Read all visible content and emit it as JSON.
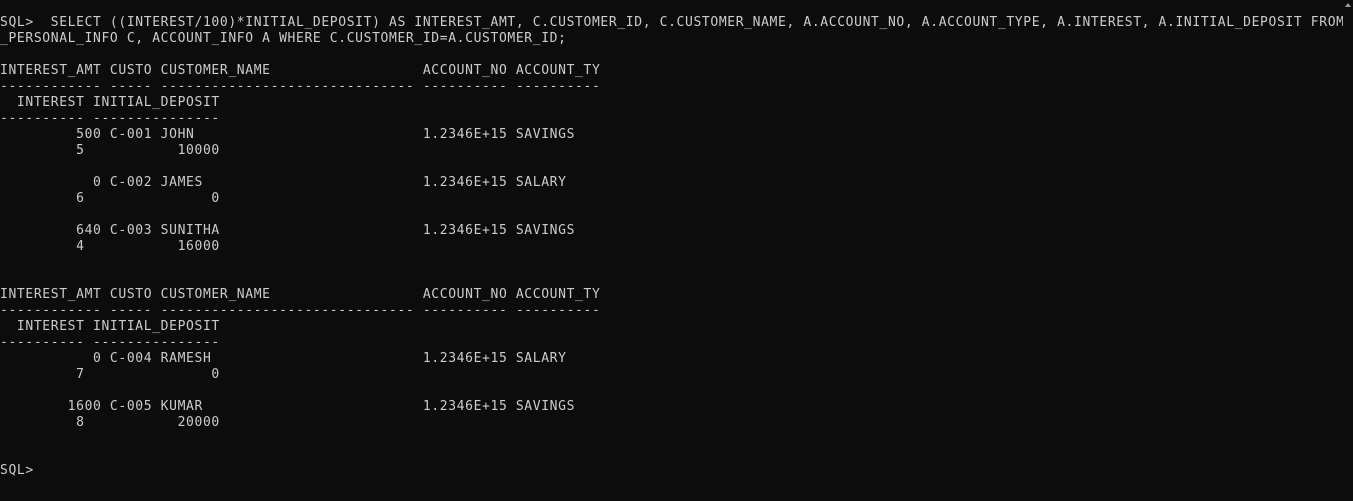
{
  "console": {
    "lines": [
      "SQL>  SELECT ((INTEREST/100)*INITIAL_DEPOSIT) AS INTEREST_AMT, C.CUSTOMER_ID, C.CUSTOMER_NAME, A.ACCOUNT_NO, A.ACCOUNT_TYPE, A.INTEREST, A.INITIAL_DEPOSIT FROM CUSTOMER",
      "_PERSONAL_INFO C, ACCOUNT_INFO A WHERE C.CUSTOMER_ID=A.CUSTOMER_ID;",
      "",
      "INTEREST_AMT CUSTO CUSTOMER_NAME                  ACCOUNT_NO ACCOUNT_TY",
      "------------ ----- ------------------------------ ---------- ----------",
      "  INTEREST INITIAL_DEPOSIT",
      "---------- ---------------",
      "         500 C-001 JOHN                           1.2346E+15 SAVINGS",
      "         5           10000",
      "",
      "           0 C-002 JAMES                          1.2346E+15 SALARY",
      "         6               0",
      "",
      "         640 C-003 SUNITHA                        1.2346E+15 SAVINGS",
      "         4           16000",
      "",
      "",
      "INTEREST_AMT CUSTO CUSTOMER_NAME                  ACCOUNT_NO ACCOUNT_TY",
      "------------ ----- ------------------------------ ---------- ----------",
      "  INTEREST INITIAL_DEPOSIT",
      "---------- ---------------",
      "           0 C-004 RAMESH                         1.2346E+15 SALARY",
      "         7               0",
      "",
      "        1600 C-005 KUMAR                          1.2346E+15 SAVINGS",
      "         8           20000",
      "",
      "",
      "SQL>"
    ]
  },
  "colors": {
    "background": "#0c0c0c",
    "text": "#cccccc"
  },
  "icons": {
    "scroll_up": "scroll-up-arrow-icon"
  }
}
